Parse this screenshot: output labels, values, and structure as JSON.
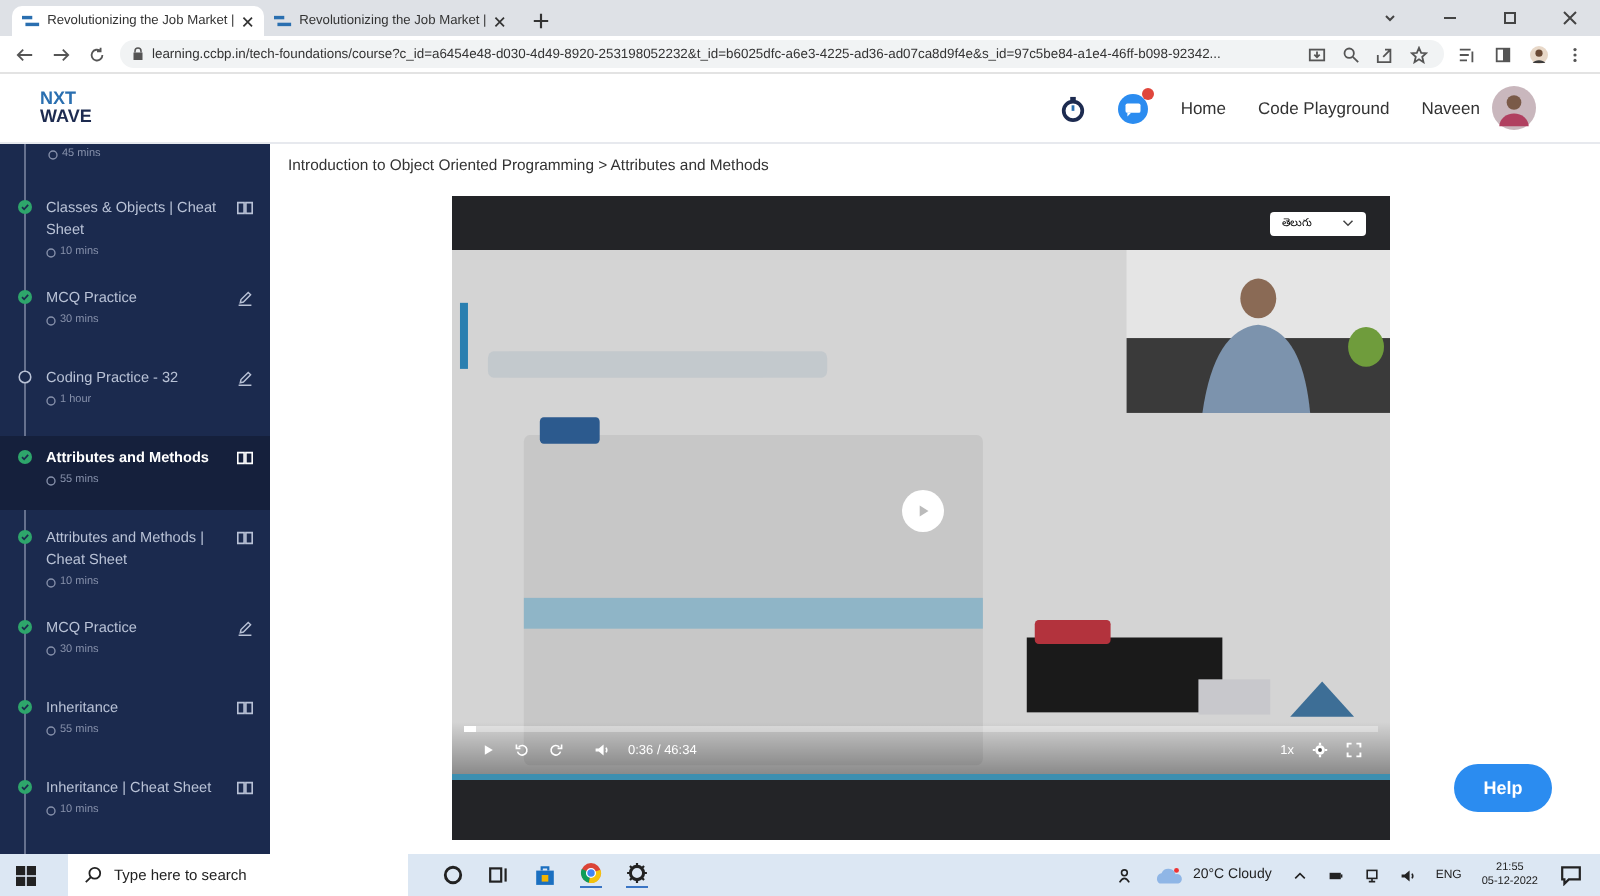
{
  "browser": {
    "tabs": [
      {
        "title": "Revolutionizing the Job Market |",
        "selected": true
      },
      {
        "title": "Revolutionizing the Job Market |",
        "selected": false
      }
    ],
    "url": "learning.ccbp.in/tech-foundations/course?c_id=a6454e48-d030-4d49-8920-253198052232&t_id=b6025dfc-a6e3-4225-ad36-ad07ca8d9f4e&s_id=97c5be84-a1e4-46ff-b098-92342..."
  },
  "header": {
    "logo": [
      "NXT",
      "WAVE"
    ],
    "notification_badge": true,
    "nav": [
      "Home",
      "Code Playground"
    ],
    "user": "Naveen"
  },
  "sidebar": {
    "top_duration": "45 mins",
    "items": [
      {
        "title": "Classes & Objects | Cheat Sheet",
        "duration": "10 mins",
        "kind": "reading",
        "completed": true,
        "selected": false
      },
      {
        "title": "MCQ Practice",
        "duration": "30 mins",
        "kind": "practice",
        "completed": true,
        "selected": false
      },
      {
        "title": "Coding Practice - 32",
        "duration": "1 hour",
        "kind": "practice",
        "completed": false,
        "selected": false
      },
      {
        "title": "Attributes and Methods",
        "duration": "55 mins",
        "kind": "reading",
        "completed": true,
        "selected": true
      },
      {
        "title": "Attributes and Methods | Cheat Sheet",
        "duration": "10 mins",
        "kind": "reading",
        "completed": true,
        "selected": false
      },
      {
        "title": "MCQ Practice",
        "duration": "30 mins",
        "kind": "practice",
        "completed": true,
        "selected": false
      },
      {
        "title": "Inheritance",
        "duration": "55 mins",
        "kind": "reading",
        "completed": true,
        "selected": false
      },
      {
        "title": "Inheritance | Cheat Sheet",
        "duration": "10 mins",
        "kind": "reading",
        "completed": true,
        "selected": false
      }
    ]
  },
  "breadcrumb": "Introduction to Object Oriented Programming > Attributes and Methods",
  "video": {
    "language": "తెలుగు",
    "time": "0:36 / 46:34",
    "speed": "1x",
    "level": 0.013
  },
  "help": "Help",
  "taskbar": {
    "search_placeholder": "Type here to search",
    "weather": "20°C Cloudy",
    "language": "ENG",
    "time": "21:55",
    "date": "05-12-2022"
  }
}
